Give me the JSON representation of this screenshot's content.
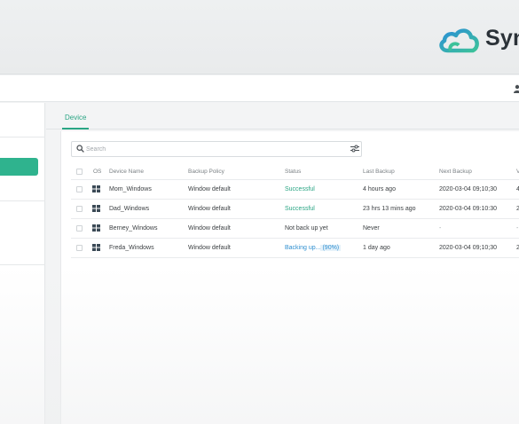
{
  "app": {
    "brand": "Syn"
  },
  "tabs": [
    {
      "label": "Device"
    }
  ],
  "search": {
    "placeholder": "Search"
  },
  "table": {
    "headers": [
      "OS",
      "Device Name",
      "Backup Policy",
      "Status",
      "Last Backup",
      "Next Backup",
      "V"
    ],
    "rows": [
      {
        "os_icon": "windows-icon",
        "device": "Mom_Windows",
        "policy": "Window default",
        "status": "Successful",
        "status_kind": "success",
        "last": "4 hours  ago",
        "next": "2020-03-04 09;10;30",
        "v": "4"
      },
      {
        "os_icon": "windows-icon",
        "device": "Dad_Windows",
        "policy": "Window default",
        "status": "Successful",
        "status_kind": "success",
        "last": "23 hrs 13 mins ago",
        "next": "2020-03-04 09:10:30",
        "v": "2"
      },
      {
        "os_icon": "windows-icon",
        "device": "Berney_Windows",
        "policy": "Window default",
        "status": "Not back up yet",
        "status_kind": "none",
        "last": "Never",
        "next": "-",
        "v": "-"
      },
      {
        "os_icon": "windows-icon",
        "device": "Freda_Windows",
        "policy": "Window default",
        "status": "Backing up...",
        "status_progress": "(90%)",
        "status_kind": "progress",
        "last": "1 day ago",
        "next": "2020-03-04 09;10;30",
        "v": "2"
      }
    ]
  },
  "colors": {
    "accent": "#2fb38e",
    "progress": "#2f8fd0",
    "logo_blue": "#2b8fd6",
    "logo_green": "#3cc29a"
  }
}
